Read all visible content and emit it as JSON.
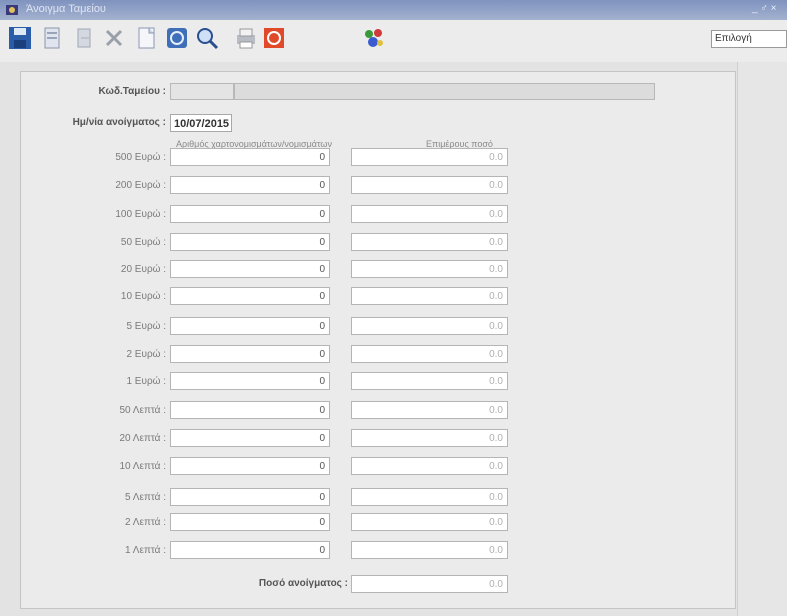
{
  "window": {
    "title": "Άνοιγμα Ταμείου",
    "controls": "_ ♂ ×"
  },
  "toolbar": {
    "buttons": [
      {
        "name": "save"
      },
      {
        "name": "delete-doc"
      },
      {
        "name": "exit"
      },
      {
        "name": "cut"
      },
      {
        "name": "new-doc"
      },
      {
        "name": "refresh"
      },
      {
        "name": "search"
      },
      {
        "name": "print"
      },
      {
        "name": "stop"
      },
      {
        "name": "palette"
      }
    ],
    "search_value": "Επιλογή"
  },
  "form": {
    "code_label": "Κωδ.Ταμείου :",
    "date_label": "Ημ/νία ανοίγματος :",
    "date_value": "10/07/2015",
    "col_count_header": "Αριθμός χαρτονομισμάτων/νομισμάτων",
    "col_amount_header": "Επιμέρους ποσό",
    "rows": [
      {
        "label": "500 Ευρώ :",
        "count": "0",
        "amount": "0.0"
      },
      {
        "label": "200 Ευρώ :",
        "count": "0",
        "amount": "0.0"
      },
      {
        "label": "100 Ευρώ :",
        "count": "0",
        "amount": "0.0"
      },
      {
        "label": "50 Ευρώ :",
        "count": "0",
        "amount": "0.0"
      },
      {
        "label": "20 Ευρώ :",
        "count": "0",
        "amount": "0.0"
      },
      {
        "label": "10 Ευρώ :",
        "count": "0",
        "amount": "0.0"
      },
      {
        "label": "5 Ευρώ :",
        "count": "0",
        "amount": "0.0"
      },
      {
        "label": "2 Ευρώ :",
        "count": "0",
        "amount": "0.0"
      },
      {
        "label": "1 Ευρώ :",
        "count": "0",
        "amount": "0.0"
      },
      {
        "label": "50 Λεπτά :",
        "count": "0",
        "amount": "0.0"
      },
      {
        "label": "20 Λεπτά :",
        "count": "0",
        "amount": "0.0"
      },
      {
        "label": "10 Λεπτά :",
        "count": "0",
        "amount": "0.0"
      },
      {
        "label": "5 Λεπτά :",
        "count": "0",
        "amount": "0.0"
      },
      {
        "label": "2 Λεπτά :",
        "count": "0",
        "amount": "0.0"
      },
      {
        "label": "1 Λεπτά :",
        "count": "0",
        "amount": "0.0"
      }
    ],
    "total_label": "Ποσό ανοίγματος :",
    "total_value": "0.0"
  }
}
